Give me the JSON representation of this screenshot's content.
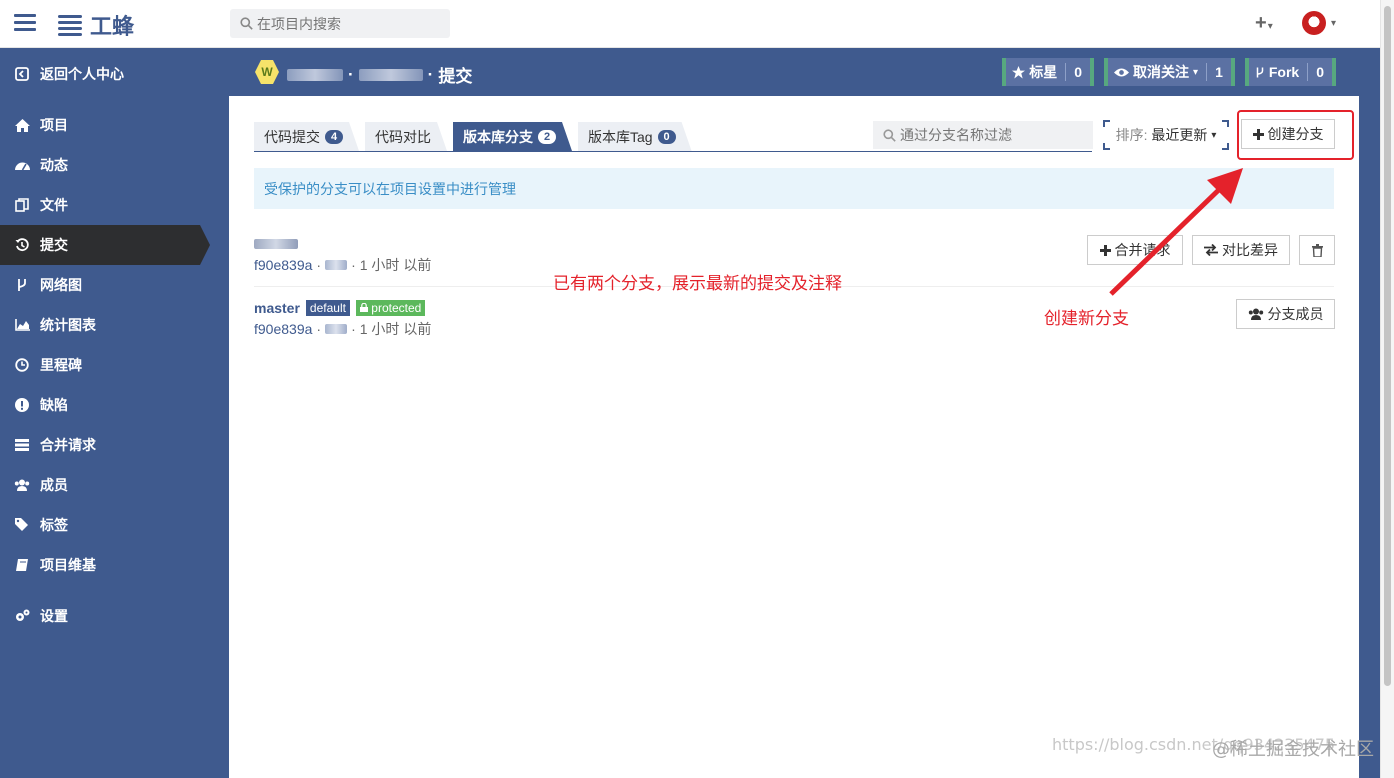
{
  "topbar": {
    "logo_text": "工蜂",
    "search_placeholder": "在项目内搜索",
    "plus_label": "+",
    "caret": "▾"
  },
  "sidebar": {
    "items": [
      {
        "label": "返回个人中心",
        "icon": "exit-icon"
      },
      {
        "label": "项目",
        "icon": "home-icon"
      },
      {
        "label": "动态",
        "icon": "dashboard-icon"
      },
      {
        "label": "文件",
        "icon": "files-icon"
      },
      {
        "label": "提交",
        "icon": "history-icon",
        "active": true
      },
      {
        "label": "网络图",
        "icon": "fork-icon"
      },
      {
        "label": "统计图表",
        "icon": "area-chart-icon"
      },
      {
        "label": "里程碑",
        "icon": "clock-icon"
      },
      {
        "label": "缺陷",
        "icon": "exclamation-icon"
      },
      {
        "label": "合并请求",
        "icon": "list-icon"
      },
      {
        "label": "成员",
        "icon": "users-icon"
      },
      {
        "label": "标签",
        "icon": "tags-icon"
      },
      {
        "label": "项目维基",
        "icon": "book-icon"
      },
      {
        "label": "设置",
        "icon": "cogs-icon"
      }
    ]
  },
  "header": {
    "project_avatar_letter": "W",
    "crumb_last": "提交",
    "crumb_sep": "·",
    "star_label": "标星",
    "star_count": "0",
    "watch_label": "取消关注",
    "watch_count": "1",
    "fork_label": "Fork",
    "fork_count": "0"
  },
  "tabs": [
    {
      "label": "代码提交",
      "badge": "4"
    },
    {
      "label": "代码对比",
      "badge": ""
    },
    {
      "label": "版本库分支",
      "badge": "2",
      "active": true
    },
    {
      "label": "版本库Tag",
      "badge": "0"
    }
  ],
  "toolbar": {
    "filter_placeholder": "通过分支名称过滤",
    "sort_prefix": "排序:",
    "sort_value": "最近更新",
    "create_label": "创建分支"
  },
  "notice": "受保护的分支可以在项目设置中进行管理",
  "branches": [
    {
      "name": "",
      "hash": "f90e839a",
      "time": "1 小时 以前",
      "merge_label": "合并请求",
      "compare_label": "对比差异"
    },
    {
      "name": "master",
      "tag_default": "default",
      "tag_protected": "protected",
      "hash": "f90e839a",
      "time": "1 小时 以前",
      "members_label": "分支成员"
    }
  ],
  "annotations": {
    "branches_note": "已有两个分支，展示最新的提交及注释",
    "create_note": "创建新分支"
  },
  "watermark": {
    "url": "https://blog.csdn.net/qq934235475",
    "site": "@稀土掘金技术社区"
  },
  "colors": {
    "brand": "#3f5a8e",
    "accent_green": "#57a87f",
    "annotation_red": "#e4222b",
    "notice_bg": "#e8f4fb"
  }
}
